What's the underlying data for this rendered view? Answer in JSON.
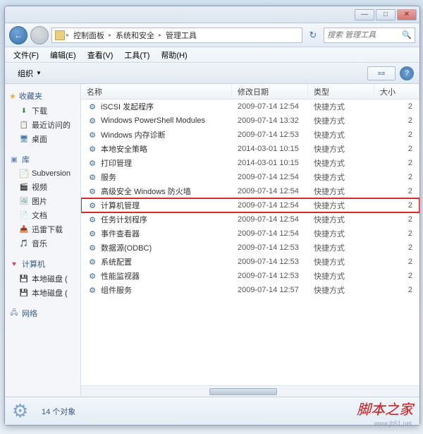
{
  "window_controls": {
    "min": "—",
    "max": "□",
    "close": "✕"
  },
  "breadcrumb": {
    "items": [
      "控制面板",
      "系统和安全",
      "管理工具"
    ]
  },
  "nav": {
    "refresh_icon": "↻",
    "search_icon": "🔍"
  },
  "search": {
    "placeholder": "搜索 管理工具"
  },
  "menubar": [
    {
      "label": "文件(F)"
    },
    {
      "label": "编辑(E)"
    },
    {
      "label": "查看(V)"
    },
    {
      "label": "工具(T)"
    },
    {
      "label": "帮助(H)"
    }
  ],
  "toolbar": {
    "organize": "组织",
    "view_icon": "≡≡",
    "help_icon": "?"
  },
  "sidebar": {
    "favorites": {
      "label": "收藏夹",
      "items": [
        {
          "label": "下载",
          "icon": "⬇"
        },
        {
          "label": "最近访问的",
          "icon": "📋"
        },
        {
          "label": "桌面",
          "icon": "🖥"
        }
      ]
    },
    "libraries": {
      "label": "库",
      "items": [
        {
          "label": "Subversion",
          "icon": "📄"
        },
        {
          "label": "视频",
          "icon": "🎬"
        },
        {
          "label": "图片",
          "icon": "🖼"
        },
        {
          "label": "文档",
          "icon": "📄"
        },
        {
          "label": "迅雷下载",
          "icon": "📥"
        },
        {
          "label": "音乐",
          "icon": "🎵"
        }
      ]
    },
    "computer": {
      "label": "计算机",
      "items": [
        {
          "label": "本地磁盘 (",
          "icon": "💾"
        },
        {
          "label": "本地磁盘 (",
          "icon": "💾"
        }
      ]
    },
    "network": {
      "label": "网络"
    }
  },
  "columns": {
    "name": "名称",
    "date": "修改日期",
    "type": "类型",
    "size": "大小"
  },
  "files": [
    {
      "name": "iSCSI 发起程序",
      "date": "2009-07-14 12:54",
      "type": "快捷方式",
      "size": "2",
      "hl": false
    },
    {
      "name": "Windows PowerShell Modules",
      "date": "2009-07-14 13:32",
      "type": "快捷方式",
      "size": "2",
      "hl": false
    },
    {
      "name": "Windows 内存诊断",
      "date": "2009-07-14 12:53",
      "type": "快捷方式",
      "size": "2",
      "hl": false
    },
    {
      "name": "本地安全策略",
      "date": "2014-03-01 10:15",
      "type": "快捷方式",
      "size": "2",
      "hl": false
    },
    {
      "name": "打印管理",
      "date": "2014-03-01 10:15",
      "type": "快捷方式",
      "size": "2",
      "hl": false
    },
    {
      "name": "服务",
      "date": "2009-07-14 12:54",
      "type": "快捷方式",
      "size": "2",
      "hl": false
    },
    {
      "name": "高级安全 Windows 防火墙",
      "date": "2009-07-14 12:54",
      "type": "快捷方式",
      "size": "2",
      "hl": false
    },
    {
      "name": "计算机管理",
      "date": "2009-07-14 12:54",
      "type": "快捷方式",
      "size": "2",
      "hl": true
    },
    {
      "name": "任务计划程序",
      "date": "2009-07-14 12:54",
      "type": "快捷方式",
      "size": "2",
      "hl": false
    },
    {
      "name": "事件查看器",
      "date": "2009-07-14 12:54",
      "type": "快捷方式",
      "size": "2",
      "hl": false
    },
    {
      "name": "数据源(ODBC)",
      "date": "2009-07-14 12:53",
      "type": "快捷方式",
      "size": "2",
      "hl": false
    },
    {
      "name": "系统配置",
      "date": "2009-07-14 12:53",
      "type": "快捷方式",
      "size": "2",
      "hl": false
    },
    {
      "name": "性能监视器",
      "date": "2009-07-14 12:53",
      "type": "快捷方式",
      "size": "2",
      "hl": false
    },
    {
      "name": "组件服务",
      "date": "2009-07-14 12:57",
      "type": "快捷方式",
      "size": "2",
      "hl": false
    }
  ],
  "statusbar": {
    "count": "14 个对象"
  },
  "watermark": {
    "main": "脚本之家",
    "sub": "www.jb51.net"
  }
}
